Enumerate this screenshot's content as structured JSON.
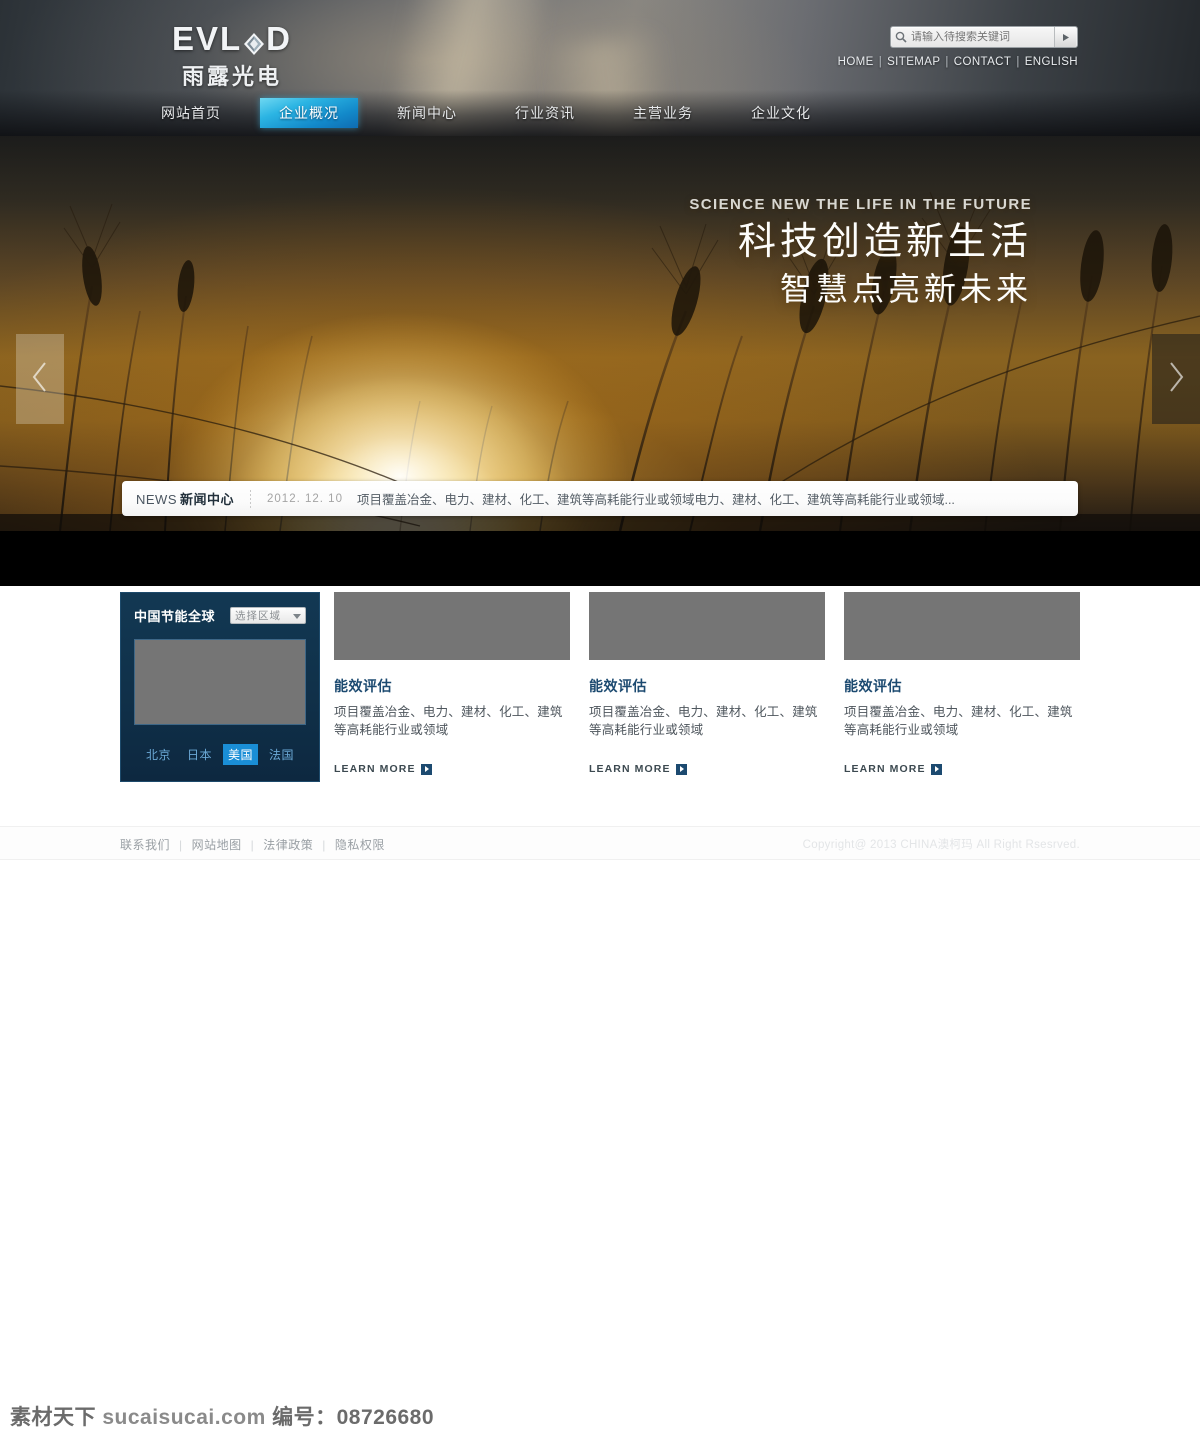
{
  "brand": {
    "logo_word_left": "EVL",
    "logo_word_right": "D",
    "logo_cn": "雨露光电"
  },
  "search": {
    "placeholder": "请输入待搜索关键词",
    "value": "",
    "icon": "search-icon",
    "submit_icon": "play-arrow-icon"
  },
  "toplinks": [
    {
      "label": "HOME"
    },
    {
      "label": "SITEMAP"
    },
    {
      "label": "CONTACT"
    },
    {
      "label": "ENGLISH"
    }
  ],
  "nav": {
    "items": [
      {
        "label": "网站首页",
        "active": false
      },
      {
        "label": "企业概况",
        "active": true
      },
      {
        "label": "新闻中心",
        "active": false
      },
      {
        "label": "行业资讯",
        "active": false
      },
      {
        "label": "主营业务",
        "active": false
      },
      {
        "label": "企业文化",
        "active": false
      }
    ],
    "active_color": "#1288c9"
  },
  "hero": {
    "english": "SCIENCE NEW THE LIFE  IN THE FUTURE",
    "line1": "科技创造新生活",
    "line2": "智慧点亮新未来",
    "prev_icon": "chevron-left-icon",
    "next_icon": "chevron-right-icon"
  },
  "news": {
    "label_en": "NEWS",
    "label_cn": "新闻中心",
    "date": "2012. 12. 10",
    "title": "项目覆盖冶金、电力、建材、化工、建筑等高耗能行业或领域电力、建材、化工、建筑等高耗能行业或领域..."
  },
  "panel": {
    "title": "中国节能全球",
    "select_label": "选择区域",
    "select_icon": "chevron-down-icon",
    "image_placeholder_color": "#757575",
    "tabs": [
      {
        "label": "北京",
        "active": false
      },
      {
        "label": "日本",
        "active": false
      },
      {
        "label": "美国",
        "active": true
      },
      {
        "label": "法国",
        "active": false
      }
    ]
  },
  "cards": [
    {
      "title": "能效评估",
      "body": "项目覆盖冶金、电力、建材、化工、建筑等高耗能行业或领域",
      "more": "LEARN MORE"
    },
    {
      "title": "能效评估",
      "body": "项目覆盖冶金、电力、建材、化工、建筑等高耗能行业或领域",
      "more": "LEARN MORE"
    },
    {
      "title": "能效评估",
      "body": "项目覆盖冶金、电力、建材、化工、建筑等高耗能行业或领域",
      "more": "LEARN MORE"
    }
  ],
  "footer": {
    "links": [
      {
        "label": "联系我们"
      },
      {
        "label": "网站地图"
      },
      {
        "label": "法律政策"
      },
      {
        "label": "隐私权限"
      }
    ],
    "copyright": "Copyright@ 2013  CHINA澳柯玛 All Right Rsesrved."
  },
  "watermark": {
    "site_cn": "素材天下",
    "site_url": "sucaisucai.com",
    "code_label": "编号：",
    "code": "08726680"
  }
}
